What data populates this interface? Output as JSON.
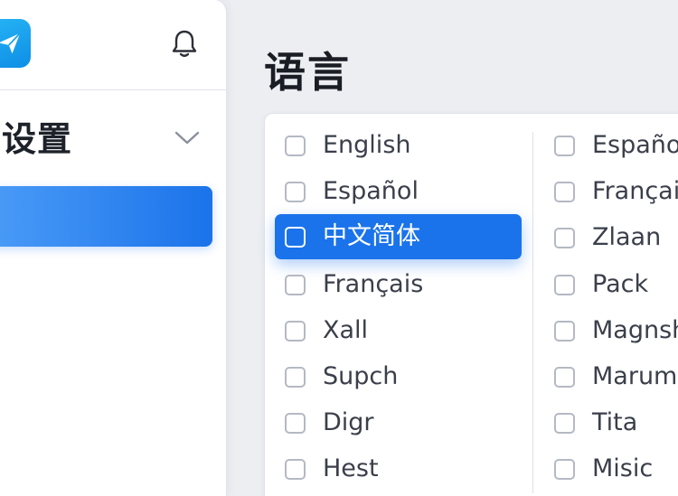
{
  "sidebar": {
    "logo_icon": "paper-plane-icon",
    "notification_icon": "bell-icon",
    "section_title": "设置",
    "section_toggle_icon": "chevron-down-icon"
  },
  "main": {
    "title": "语言",
    "languages_left": [
      {
        "label": "English",
        "selected": false
      },
      {
        "label": "Español",
        "selected": false
      },
      {
        "label": "中文简体",
        "selected": true
      },
      {
        "label": "Français",
        "selected": false
      },
      {
        "label": "Xall",
        "selected": false
      },
      {
        "label": "Supch",
        "selected": false
      },
      {
        "label": "Digr",
        "selected": false
      },
      {
        "label": "Hest",
        "selected": false
      }
    ],
    "languages_right": [
      {
        "label": "Español",
        "selected": false
      },
      {
        "label": "Français",
        "selected": false
      },
      {
        "label": "Zlaan",
        "selected": false
      },
      {
        "label": "Pack",
        "selected": false
      },
      {
        "label": "Magnsh",
        "selected": false
      },
      {
        "label": "Maruma",
        "selected": false
      },
      {
        "label": "Tita",
        "selected": false
      },
      {
        "label": "Misic",
        "selected": false
      }
    ]
  },
  "colors": {
    "accent": "#1a73eb",
    "logo": "#16a0ef",
    "background": "#eceef2"
  }
}
